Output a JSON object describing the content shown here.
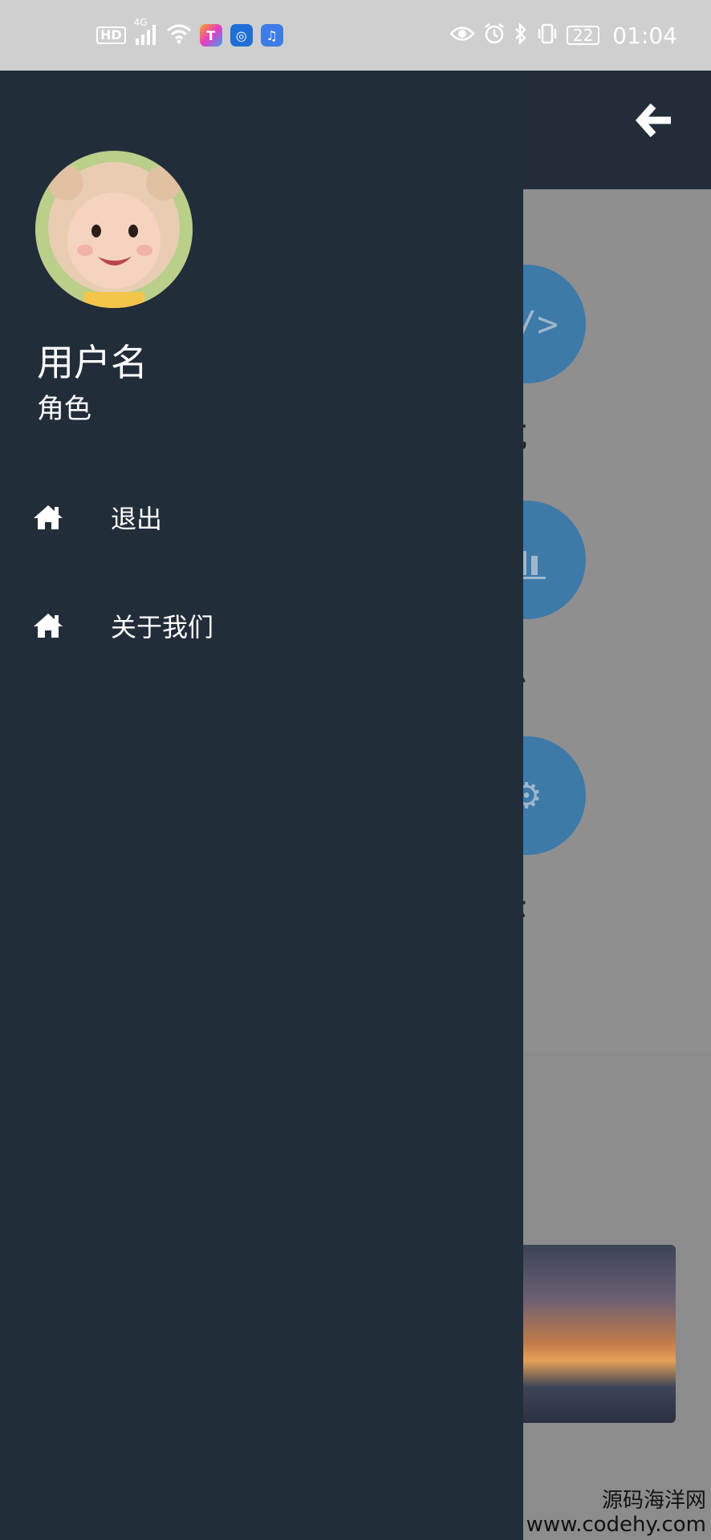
{
  "status_bar": {
    "left_icons": [
      "hd-icon",
      "4g-signal-icon",
      "wifi-icon",
      "app-icon-1",
      "app-icon-2",
      "music-app-icon"
    ],
    "hd_text": "HD",
    "network": "4G",
    "right_icons": [
      "eye-icon",
      "alarm-icon",
      "bluetooth-icon",
      "vibrate-icon",
      "battery-icon"
    ],
    "battery": "22",
    "time": "01:04"
  },
  "drawer": {
    "user_name": "用户名",
    "user_role": "角色",
    "menu": [
      {
        "label": "退出",
        "icon": "home-icon"
      },
      {
        "label": "关于我们",
        "icon": "home-icon"
      }
    ]
  },
  "background_page": {
    "nav_items": [
      {
        "label": "导航",
        "icon": "code-icon"
      },
      {
        "label": "信息",
        "icon": "chart-icon"
      },
      {
        "label": "展示",
        "icon": "gear-icon"
      }
    ]
  },
  "watermark": {
    "line1": "源码海洋网",
    "line2": "www.codehy.com"
  },
  "colors": {
    "drawer_bg": "#222d3a",
    "appbar_bg": "#232d3a",
    "accent_circle": "#3d7aa8",
    "status_bar_bg": "#cfcfcf"
  }
}
